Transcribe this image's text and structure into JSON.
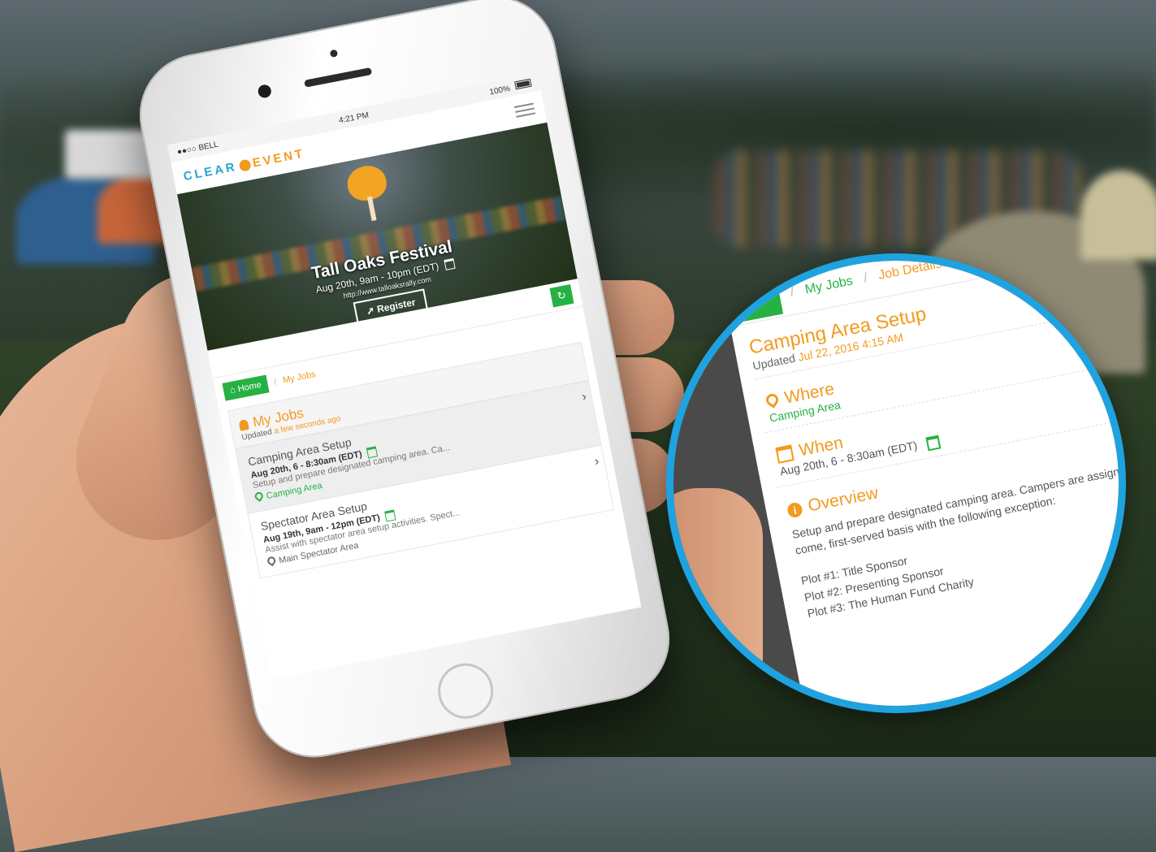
{
  "status_bar": {
    "carrier": "●●○○ BELL",
    "time": "4:21 PM",
    "battery": "100%"
  },
  "app": {
    "logo_left": "CLEAR",
    "logo_right": "EVENT"
  },
  "event": {
    "title": "Tall Oaks Festival",
    "datetime": "Aug 20th, 9am - 10pm (EDT)",
    "url": "http://www.talloaksrally.com",
    "register_label": "Register"
  },
  "breadcrumb": {
    "home": "Home",
    "my_jobs": "My Jobs"
  },
  "jobs": {
    "title": "My Jobs",
    "updated_prefix": "Updated",
    "updated_time": "a few seconds ago",
    "items": [
      {
        "title": "Camping Area Setup",
        "time": "Aug 20th, 6 - 8:30am (EDT)",
        "description": "Setup and prepare designated camping area. Ca...",
        "location": "Camping Area"
      },
      {
        "title": "Spectator Area Setup",
        "time": "Aug 19th, 9am - 12pm (EDT)",
        "description": "Assist with spectator area setup activities. Spect...",
        "location": "Main Spectator Area"
      }
    ]
  },
  "zoom": {
    "crumb_home": "Home",
    "crumb_my_jobs": "My Jobs",
    "crumb_current": "Job Details...",
    "job_title": "Camping Area Setup",
    "updated_prefix": "Updated",
    "updated_time": "Jul 22, 2016 4:15 AM",
    "where_label": "Where",
    "where_value": "Camping Area",
    "when_label": "When",
    "when_value": "Aug 20th, 6 - 8:30am (EDT)",
    "overview_label": "Overview",
    "overview_text": "Setup and prepare designated camping area. Campers are assigned on a first-come, first-served basis with the following exception:",
    "plots": [
      "Plot #1: Title Sponsor",
      "Plot #2: Presenting Sponsor",
      "Plot #3: The Human Fund Charity"
    ]
  },
  "colors": {
    "green": "#26b143",
    "orange": "#f39a1e",
    "blue": "#1ea3e0"
  },
  "icons": [
    "wifi-icon",
    "battery-icon",
    "menu-icon",
    "tree-logo-icon",
    "calendar-icon",
    "register-icon",
    "refresh-icon",
    "home-icon",
    "user-icon",
    "chevron-right-icon",
    "map-pin-icon",
    "info-icon"
  ]
}
